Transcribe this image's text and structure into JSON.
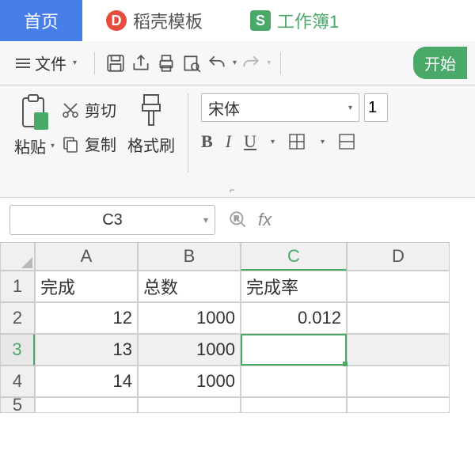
{
  "tabs": {
    "home": "首页",
    "docer": "稻壳模板",
    "workbook": "工作簿1"
  },
  "toolbar": {
    "file": "文件",
    "start": "开始"
  },
  "ribbon": {
    "paste": "粘贴",
    "cut": "剪切",
    "copy": "复制",
    "format_brush": "格式刷",
    "font_name": "宋体",
    "font_size": "1",
    "bold": "B",
    "italic": "I",
    "underline": "U"
  },
  "namebox": {
    "ref": "C3",
    "fx": "fx"
  },
  "grid": {
    "cols": [
      "A",
      "B",
      "C",
      "D"
    ],
    "rows": [
      "1",
      "2",
      "3",
      "4",
      "5"
    ],
    "headers": {
      "A": "完成",
      "B": "总数",
      "C": "完成率"
    },
    "data": [
      {
        "A": "12",
        "B": "1000",
        "C": "0.012"
      },
      {
        "A": "13",
        "B": "1000",
        "C": ""
      },
      {
        "A": "14",
        "B": "1000",
        "C": ""
      }
    ],
    "active_cell": "C3"
  }
}
